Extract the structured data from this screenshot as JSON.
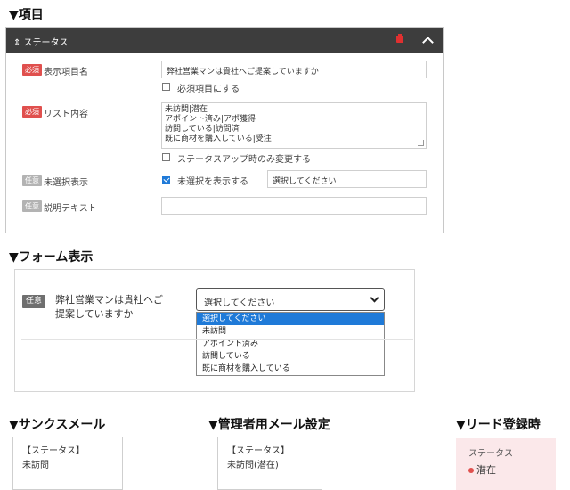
{
  "sections": {
    "item_title": "▼項目",
    "form_title": "▼フォーム表示",
    "thanks_title": "▼サンクスメール",
    "admin_title": "▼管理者用メール設定",
    "lead_title": "▼リード登録時"
  },
  "panel": {
    "header_label": "⇕ ステータス",
    "rows": {
      "display_name": {
        "badge": "必須",
        "label": "表示項目名",
        "value": "弊社営業マンは貴社へご提案していますか",
        "checkbox_label": "必須項目にする",
        "checkbox_checked": false
      },
      "list": {
        "badge": "必須",
        "label": "リスト内容",
        "lines": [
          "未訪問|潜在",
          "アポイント済み|アポ獲得",
          "訪問している|訪問済",
          "既に商材を購入している|受注"
        ],
        "checkbox_label": "ステータスアップ時のみ変更する",
        "checkbox_checked": false
      },
      "unselected": {
        "badge": "任意",
        "label": "未選択表示",
        "checkbox_label": "未選択を表示する",
        "checkbox_checked": true,
        "value": "選択してください"
      },
      "description": {
        "badge": "任意",
        "label": "説明テキスト",
        "value": ""
      }
    }
  },
  "form_preview": {
    "badge": "任意",
    "question_line1": "弊社営業マンは貴社へご",
    "question_line2": "提案していますか",
    "select_value": "選択してください",
    "options": [
      "選択してください",
      "未訪問",
      "アポイント済み",
      "訪問している",
      "既に商材を購入している"
    ],
    "selected_index": 0
  },
  "thanks_mail": {
    "line1": "【ステータス】",
    "line2": "未訪問"
  },
  "admin_mail": {
    "line1": "【ステータス】",
    "line2": "未訪問(潜在)"
  },
  "lead": {
    "label": "ステータス",
    "value": "潜在"
  },
  "colors": {
    "accent": "#1f7ad8",
    "required": "#e0504e",
    "header": "#3d3d3d",
    "lead_bg": "#fbe8ea"
  }
}
